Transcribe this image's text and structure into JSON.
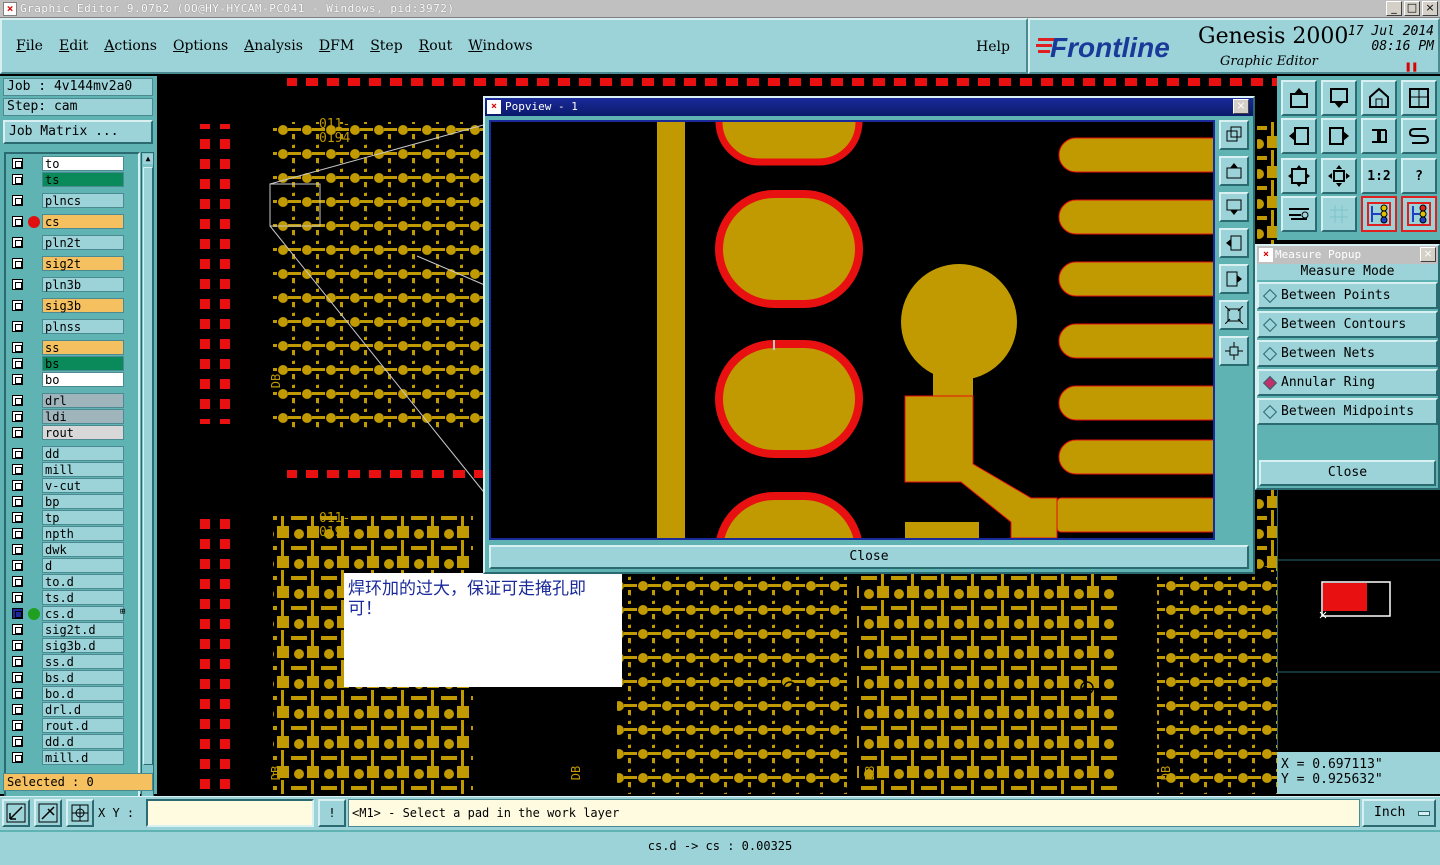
{
  "window": {
    "title": "Graphic Editor 9.07b2 (OO@HY-HYCAM-PC041 - Windows, pid:3972)",
    "minimize": "_",
    "maximize": "□",
    "close": "×"
  },
  "menu": {
    "items": [
      "File",
      "Edit",
      "Actions",
      "Options",
      "Analysis",
      "DFM",
      "Step",
      "Rout",
      "Windows"
    ],
    "help": "Help"
  },
  "brand": {
    "logo": "Frontline",
    "product": "Genesis 2000",
    "subtitle": "Graphic Editor",
    "date": "17 Jul 2014",
    "time": "08:16 PM"
  },
  "job": {
    "job_line": "Job : 4v144mv2a0",
    "step_line": "Step: cam",
    "matrix_button": "Job Matrix ..."
  },
  "layers": [
    {
      "name": "to",
      "color": "#ffffff",
      "marker": ""
    },
    {
      "name": "ts",
      "color": "#0a8a5a",
      "marker": ""
    },
    {
      "name": "plncs",
      "color": "#9bd3d8",
      "marker": ""
    },
    {
      "name": "cs",
      "color": "#f4c060",
      "marker": "#e01010"
    },
    {
      "name": "pln2t",
      "color": "#9bd3d8",
      "marker": ""
    },
    {
      "name": "sig2t",
      "color": "#f4c060",
      "marker": ""
    },
    {
      "name": "pln3b",
      "color": "#9bd3d8",
      "marker": ""
    },
    {
      "name": "sig3b",
      "color": "#f4c060",
      "marker": ""
    },
    {
      "name": "plnss",
      "color": "#9bd3d8",
      "marker": ""
    },
    {
      "name": "ss",
      "color": "#f4c060",
      "marker": ""
    },
    {
      "name": "bs",
      "color": "#0a8a5a",
      "marker": ""
    },
    {
      "name": "bo",
      "color": "#ffffff",
      "marker": ""
    },
    {
      "name": "drl",
      "color": "#a0b4bc",
      "marker": ""
    },
    {
      "name": "ldi",
      "color": "#a0b4bc",
      "marker": ""
    },
    {
      "name": "rout",
      "color": "#d8d8d8",
      "marker": ""
    },
    {
      "name": "dd",
      "color": "#9bd3d8",
      "marker": ""
    },
    {
      "name": "mill",
      "color": "#9bd3d8",
      "marker": ""
    },
    {
      "name": "v-cut",
      "color": "#9bd3d8",
      "marker": ""
    },
    {
      "name": "bp",
      "color": "#9bd3d8",
      "marker": ""
    },
    {
      "name": "tp",
      "color": "#9bd3d8",
      "marker": ""
    },
    {
      "name": "npth",
      "color": "#9bd3d8",
      "marker": ""
    },
    {
      "name": "dwk",
      "color": "#9bd3d8",
      "marker": ""
    },
    {
      "name": "d",
      "color": "#9bd3d8",
      "marker": ""
    },
    {
      "name": "to.d",
      "color": "#9bd3d8",
      "marker": ""
    },
    {
      "name": "ts.d",
      "color": "#9bd3d8",
      "marker": ""
    },
    {
      "name": "cs.d",
      "color": "#9bd3d8",
      "marker": "#20a020",
      "work": true
    },
    {
      "name": "sig2t.d",
      "color": "#9bd3d8",
      "marker": ""
    },
    {
      "name": "sig3b.d",
      "color": "#9bd3d8",
      "marker": ""
    },
    {
      "name": "ss.d",
      "color": "#9bd3d8",
      "marker": ""
    },
    {
      "name": "bs.d",
      "color": "#9bd3d8",
      "marker": ""
    },
    {
      "name": "bo.d",
      "color": "#9bd3d8",
      "marker": ""
    },
    {
      "name": "drl.d",
      "color": "#9bd3d8",
      "marker": ""
    },
    {
      "name": "rout.d",
      "color": "#9bd3d8",
      "marker": ""
    },
    {
      "name": "dd.d",
      "color": "#9bd3d8",
      "marker": ""
    },
    {
      "name": "mill.d",
      "color": "#9bd3d8",
      "marker": ""
    }
  ],
  "selected": "Selected : 0",
  "popview": {
    "title": "Popview - 1",
    "close": "Close"
  },
  "note": "焊环加的过大，保证可走掩孔即可！",
  "board_labels": {
    "code1": "011-",
    "code2": "0194",
    "db": "DB"
  },
  "toolbox": {
    "scale_label": "1:2",
    "help_label": "?"
  },
  "measure": {
    "title": "Measure Popup",
    "mode_label": "Measure Mode",
    "options": [
      "Between Points",
      "Between Contours",
      "Between Nets",
      "Annular Ring",
      "Between Midpoints"
    ],
    "active": "Annular Ring",
    "close": "Close"
  },
  "coords": {
    "x": "X = 0.697113\"",
    "y": "Y = 0.925632\""
  },
  "bottom": {
    "xy_label": "X Y :",
    "xy_value": "",
    "alert": "!",
    "prompt": "<M1> - Select a pad in the work layer",
    "unit": "Inch"
  },
  "status": "cs.d -> cs : 0.00325",
  "colors": {
    "copper": "#c09a00",
    "mask": "#e81010",
    "panel": "#9bd3d8",
    "panel_dark": "#5fb3b3"
  }
}
